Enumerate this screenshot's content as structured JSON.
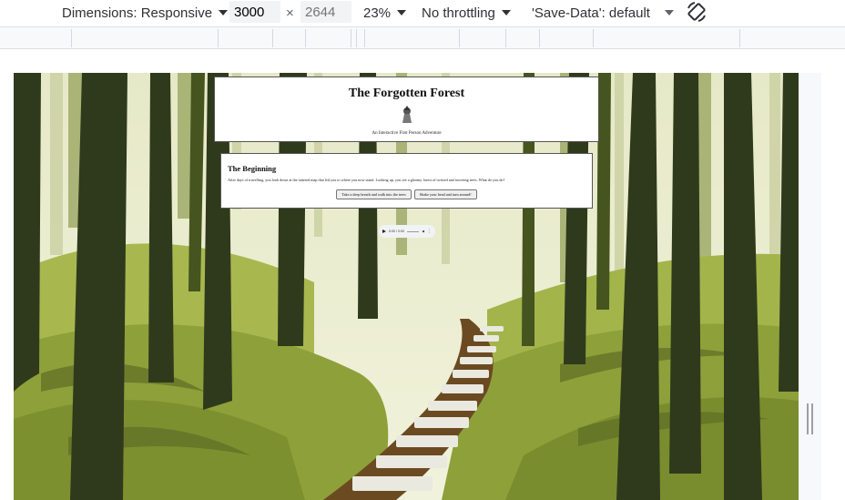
{
  "devtools": {
    "dimensions_label": "Dimensions: Responsive",
    "width_value": "3000",
    "times_sign": "×",
    "height_placeholder": "2644",
    "zoom_label": "23%",
    "throttling_label": "No throttling",
    "save_data_label": "'Save-Data': default",
    "rotate_icon": "rotate-icon"
  },
  "page": {
    "title": "The Forgotten Forest",
    "subtitle": "An Interactive First Person Adventure",
    "scene_title": "The Beginning",
    "scene_text": "After days of travelling, you look down at the tattered map that led you to where you now stand. Looking up, you see a gloomy forest of twisted and towering trees. What do you do?",
    "choices": [
      {
        "label": "Take a deep breath and walk into the trees"
      },
      {
        "label": "Shake your head and turn around!"
      }
    ],
    "audio_time": "0:00 / 0:00"
  },
  "colors": {
    "forest_light": "#e8ebcc",
    "forest_mid": "#8fa33d",
    "forest_dark": "#2f3a1c",
    "path": "#6b4a22"
  }
}
